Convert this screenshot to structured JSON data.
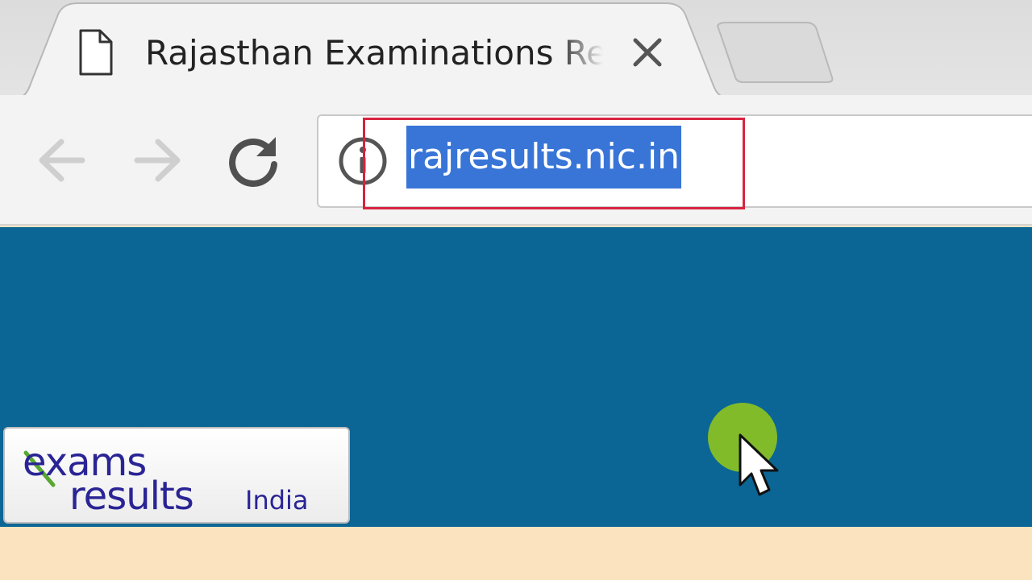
{
  "browser": {
    "tab": {
      "title": "Rajasthan Examinations Results",
      "favicon": "page-icon",
      "close_icon": "close-icon"
    },
    "new_tab_icon": "new-tab-icon",
    "nav": {
      "back_icon": "back-arrow-icon",
      "forward_icon": "forward-arrow-icon",
      "reload_icon": "reload-icon"
    },
    "omnibox": {
      "info_icon": "info-icon",
      "url": "rajresults.nic.in",
      "selected": true,
      "highlight_color": "#d8233f"
    }
  },
  "page": {
    "banner_color": "#0b6696",
    "footer_color": "#fbe3bf",
    "logo": {
      "line1": "exams",
      "line2": "results",
      "suffix": "India"
    }
  },
  "cursor": {
    "click_indicator_color": "#8dc21f",
    "icon": "mouse-pointer-icon"
  }
}
